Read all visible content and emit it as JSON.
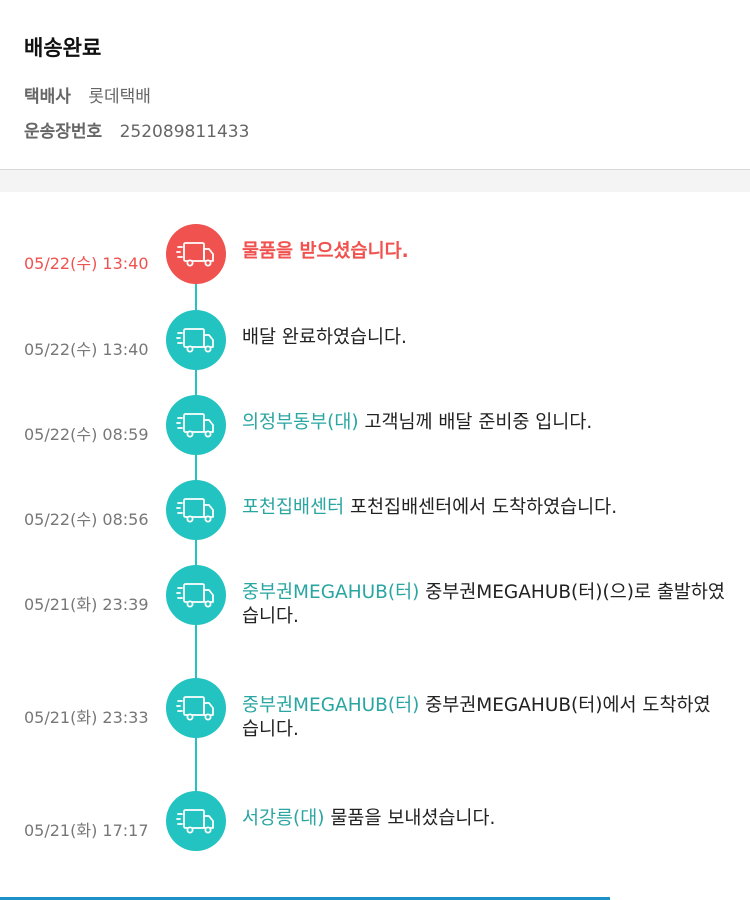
{
  "header": {
    "status": "배송완료",
    "courier_label": "택배사",
    "courier_value": "롯데택배",
    "tracking_label": "운송장번호",
    "tracking_value": "252089811433"
  },
  "events": [
    {
      "time": "05/22(수) 13:40",
      "location": "",
      "message": "물품을 받으셨습니다.",
      "icon": "truck-icon",
      "highlight": true
    },
    {
      "time": "05/22(수) 13:40",
      "location": "",
      "message": "배달 완료하였습니다.",
      "icon": "truck-icon"
    },
    {
      "time": "05/22(수) 08:59",
      "location": "의정부동부(대)",
      "message": "고객님께 배달 준비중 입니다.",
      "icon": "truck-icon"
    },
    {
      "time": "05/22(수) 08:56",
      "location": "포천집배센터",
      "message": "포천집배센터에서 도착하였습니다.",
      "icon": "truck-icon"
    },
    {
      "time": "05/21(화) 23:39",
      "location": "중부권MEGAHUB(터)",
      "message": "중부권MEGAHUB(터)(으)로 출발하였습니다.",
      "icon": "truck-icon"
    },
    {
      "time": "05/21(화) 23:33",
      "location": "중부권MEGAHUB(터)",
      "message": "중부권MEGAHUB(터)에서 도착하였습니다.",
      "icon": "truck-icon"
    },
    {
      "time": "05/21(화) 17:17",
      "location": "서강릉(대)",
      "message": "물품을 보내셨습니다.",
      "icon": "truck-icon"
    }
  ],
  "colors": {
    "accent": "#22c3c0",
    "highlight": "#f0524f",
    "location": "#2aa6a2"
  }
}
